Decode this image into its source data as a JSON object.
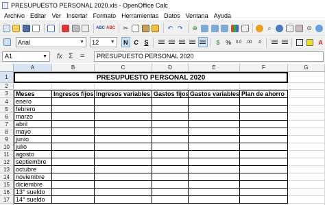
{
  "window": {
    "title": "PRESUPUESTO PERSONAL 2020.xls - OpenOffice Calc"
  },
  "menu": [
    "Archivo",
    "Editar",
    "Ver",
    "Insertar",
    "Formato",
    "Herramientas",
    "Datos",
    "Ventana",
    "Ayuda"
  ],
  "toolbar": {
    "font_name": "Arial",
    "font_size": "12",
    "bold_label": "N",
    "italic_label": "C",
    "underline_label": "S"
  },
  "formula_bar": {
    "cell_ref": "A1",
    "fx_label": "fx",
    "sum_label": "Σ",
    "equals_label": "=",
    "content": "PRESUPUESTO PERSONAL 2020"
  },
  "sheet": {
    "columns": [
      "A",
      "B",
      "C",
      "D",
      "E",
      "F",
      "G"
    ],
    "rows": [
      "1",
      "2",
      "3",
      "4",
      "5",
      "6",
      "7",
      "8",
      "9",
      "10",
      "11",
      "12",
      "13",
      "14",
      "15",
      "16",
      "17",
      "18"
    ],
    "title": "PRESUPUESTO PERSONAL 2020",
    "headers": [
      "Meses",
      "Ingresos fijos",
      "Ingresos variables",
      "Gastos fijos",
      "Gastos variables",
      "Plan de ahorro"
    ],
    "months": [
      "enero",
      "febrero",
      "marzo",
      "abril",
      "mayo",
      "junio",
      "julio",
      "agosto",
      "septiembre",
      "octubre",
      "noviembre",
      "diciembre",
      "13° sueldo",
      "14° sueldo"
    ]
  }
}
